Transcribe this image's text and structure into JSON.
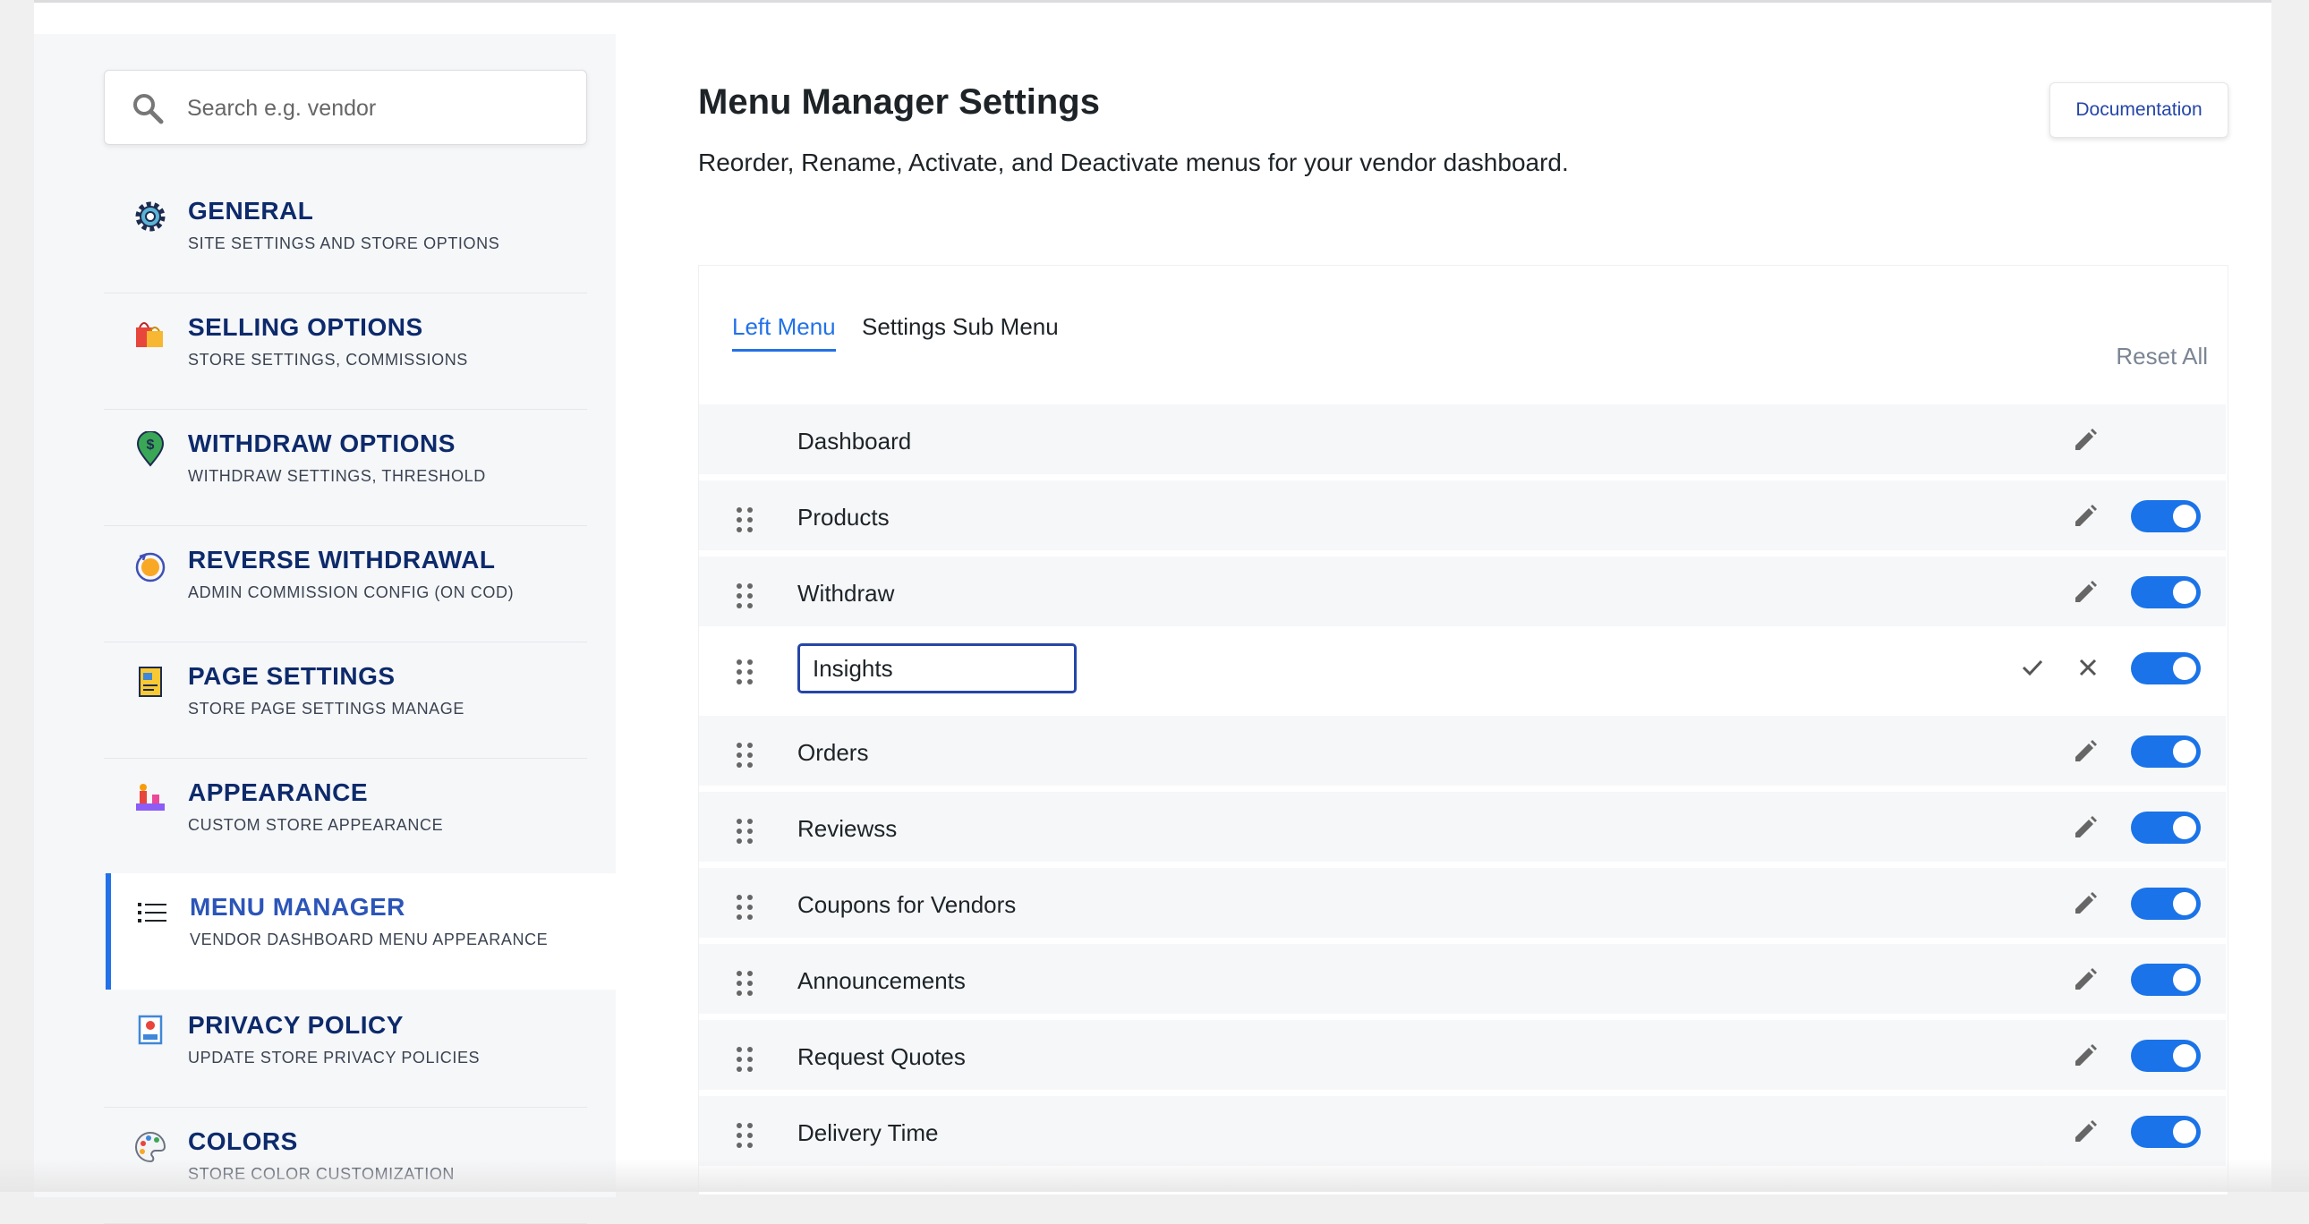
{
  "sidebar": {
    "search_placeholder": "Search e.g. vendor",
    "items": [
      {
        "title": "GENERAL",
        "subtitle": "SITE SETTINGS AND STORE OPTIONS",
        "icon": "gear-icon"
      },
      {
        "title": "SELLING OPTIONS",
        "subtitle": "STORE SETTINGS, COMMISSIONS",
        "icon": "shopping-bags-icon"
      },
      {
        "title": "WITHDRAW OPTIONS",
        "subtitle": "WITHDRAW SETTINGS, THRESHOLD",
        "icon": "dollar-pin-icon"
      },
      {
        "title": "REVERSE WITHDRAWAL",
        "subtitle": "ADMIN COMMISSION CONFIG (ON COD)",
        "icon": "coin-cycle-icon"
      },
      {
        "title": "PAGE SETTINGS",
        "subtitle": "STORE PAGE SETTINGS MANAGE",
        "icon": "page-icon"
      },
      {
        "title": "APPEARANCE",
        "subtitle": "CUSTOM STORE APPEARANCE",
        "icon": "appearance-icon"
      },
      {
        "title": "MENU MANAGER",
        "subtitle": "VENDOR DASHBOARD MENU APPEARANCE",
        "icon": "list-icon",
        "active": true
      },
      {
        "title": "PRIVACY POLICY",
        "subtitle": "UPDATE STORE PRIVACY POLICIES",
        "icon": "privacy-icon"
      },
      {
        "title": "COLORS",
        "subtitle": "STORE COLOR CUSTOMIZATION",
        "icon": "palette-icon"
      }
    ]
  },
  "header": {
    "title": "Menu Manager Settings",
    "subtitle": "Reorder, Rename, Activate, and Deactivate menus for your vendor dashboard.",
    "doc_button": "Documentation"
  },
  "tabs": [
    {
      "label": "Left Menu",
      "active": true
    },
    {
      "label": "Settings Sub Menu",
      "active": false
    }
  ],
  "reset_label": "Reset All",
  "menu_rows": [
    {
      "label": "Dashboard",
      "draggable": false,
      "toggle": false,
      "enabled": true
    },
    {
      "label": "Products",
      "draggable": true,
      "toggle": true,
      "enabled": true
    },
    {
      "label": "Withdraw",
      "draggable": true,
      "toggle": true,
      "enabled": true
    },
    {
      "label": "Insights",
      "draggable": true,
      "toggle": true,
      "enabled": true,
      "editing": true
    },
    {
      "label": "Orders",
      "draggable": true,
      "toggle": true,
      "enabled": true
    },
    {
      "label": "Reviewss",
      "draggable": true,
      "toggle": true,
      "enabled": true
    },
    {
      "label": "Coupons for Vendors",
      "draggable": true,
      "toggle": true,
      "enabled": true
    },
    {
      "label": "Announcements",
      "draggable": true,
      "toggle": true,
      "enabled": true
    },
    {
      "label": "Request Quotes",
      "draggable": true,
      "toggle": true,
      "enabled": true
    },
    {
      "label": "Delivery Time",
      "draggable": true,
      "toggle": true,
      "enabled": true
    }
  ],
  "colors": {
    "accent": "#2271e8",
    "nav_title": "#0d2a6b",
    "toggle_on": "#1a73e8"
  }
}
